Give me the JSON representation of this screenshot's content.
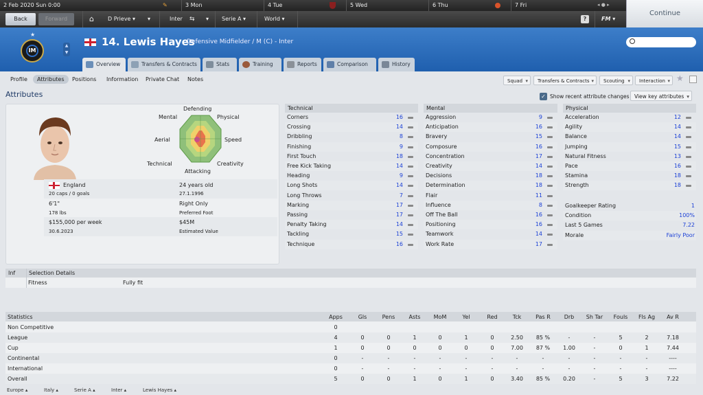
{
  "calendar": {
    "date": "2 Feb 2020",
    "day": "Sun",
    "time": "0:00",
    "days": [
      {
        "n": "3",
        "d": "Mon"
      },
      {
        "n": "4",
        "d": "Tue"
      },
      {
        "n": "5",
        "d": "Wed"
      },
      {
        "n": "6",
        "d": "Thu"
      },
      {
        "n": "7",
        "d": "Fri"
      }
    ]
  },
  "nav": {
    "back": "Back",
    "forward": "Forward",
    "manager": "D Prieve",
    "club": "Inter",
    "league": "Serie A",
    "world": "World",
    "help": "?",
    "fm": "FM",
    "continue": "Continue"
  },
  "player": {
    "title": "14. Lewis Hayes",
    "role": "Defensive Midfielder / M (C) - Inter"
  },
  "tabs": [
    "Overview",
    "Transfers & Contracts",
    "Stats",
    "Training",
    "Reports",
    "Comparison",
    "History"
  ],
  "subnav": [
    "Profile",
    "Attributes",
    "Positions",
    "Information",
    "Private Chat",
    "Notes"
  ],
  "actions": [
    "Squad",
    "Transfers & Contracts",
    "Scouting",
    "Interaction"
  ],
  "section_title": "Attributes",
  "show_recent": "Show recent attribute changes",
  "view_key": "View key attributes",
  "radar": {
    "labels": [
      "Defending",
      "Physical",
      "Speed",
      "Creativity",
      "Attacking",
      "Technical",
      "Aerial",
      "Mental"
    ]
  },
  "info": [
    {
      "main": "England",
      "sub": "20 caps / 0 goals",
      "rmain": "24 years old",
      "rsub": "27.1.1996"
    },
    {
      "main": "6'1\"",
      "sub": "178 lbs",
      "rmain": "Right Only",
      "rsub": "Preferred Foot"
    },
    {
      "main": "$155,000 per week",
      "sub": "30.6.2023",
      "rmain": "$45M",
      "rsub": "Estimated Value"
    }
  ],
  "technical": {
    "title": "Technical",
    "rows": [
      [
        "Corners",
        "16"
      ],
      [
        "Crossing",
        "14"
      ],
      [
        "Dribbling",
        "8"
      ],
      [
        "Finishing",
        "9"
      ],
      [
        "First Touch",
        "18"
      ],
      [
        "Free Kick Taking",
        "14"
      ],
      [
        "Heading",
        "9"
      ],
      [
        "Long Shots",
        "14"
      ],
      [
        "Long Throws",
        "7"
      ],
      [
        "Marking",
        "17"
      ],
      [
        "Passing",
        "17"
      ],
      [
        "Penalty Taking",
        "14"
      ],
      [
        "Tackling",
        "15"
      ],
      [
        "Technique",
        "16"
      ]
    ]
  },
  "mental": {
    "title": "Mental",
    "rows": [
      [
        "Aggression",
        "9"
      ],
      [
        "Anticipation",
        "16"
      ],
      [
        "Bravery",
        "15"
      ],
      [
        "Composure",
        "16"
      ],
      [
        "Concentration",
        "17"
      ],
      [
        "Creativity",
        "14"
      ],
      [
        "Decisions",
        "18"
      ],
      [
        "Determination",
        "18"
      ],
      [
        "Flair",
        "11"
      ],
      [
        "Influence",
        "8"
      ],
      [
        "Off The Ball",
        "16"
      ],
      [
        "Positioning",
        "16"
      ],
      [
        "Teamwork",
        "14"
      ],
      [
        "Work Rate",
        "17"
      ]
    ]
  },
  "physical": {
    "title": "Physical",
    "rows": [
      [
        "Acceleration",
        "12"
      ],
      [
        "Agility",
        "14"
      ],
      [
        "Balance",
        "14"
      ],
      [
        "Jumping",
        "15"
      ],
      [
        "Natural Fitness",
        "13"
      ],
      [
        "Pace",
        "16"
      ],
      [
        "Stamina",
        "18"
      ],
      [
        "Strength",
        "18"
      ]
    ]
  },
  "misc": [
    [
      "Goalkeeper Rating",
      "1"
    ],
    [
      "Condition",
      "100%"
    ],
    [
      "Last 5 Games",
      "7.22"
    ],
    [
      "Morale",
      "Fairly Poor"
    ]
  ],
  "selection": {
    "inf": "Inf",
    "header": "Selection Details",
    "label": "Fitness",
    "value": "Fully fit"
  },
  "stats": {
    "headers": [
      "Statistics",
      "Apps",
      "Gls",
      "Pens",
      "Asts",
      "MoM",
      "Yel",
      "Red",
      "Tck",
      "Pas R",
      "Drb",
      "Sh Tar",
      "Fouls",
      "Fls Ag",
      "Av R"
    ],
    "rows": [
      [
        "Non Competitive",
        "0",
        "",
        "",
        "",
        "",
        "",
        "",
        "",
        "",
        "",
        "",
        "",
        "",
        ""
      ],
      [
        "League",
        "4",
        "0",
        "0",
        "1",
        "0",
        "1",
        "0",
        "2.50",
        "85 %",
        "-",
        "-",
        "5",
        "2",
        "7.18"
      ],
      [
        "Cup",
        "1",
        "0",
        "0",
        "0",
        "0",
        "0",
        "0",
        "7.00",
        "87 %",
        "1.00",
        "-",
        "0",
        "1",
        "7.44"
      ],
      [
        "Continental",
        "0",
        "-",
        "-",
        "-",
        "-",
        "-",
        "-",
        "-",
        "-",
        "-",
        "-",
        "-",
        "-",
        "----"
      ],
      [
        "International",
        "0",
        "-",
        "-",
        "-",
        "-",
        "-",
        "-",
        "-",
        "-",
        "-",
        "-",
        "-",
        "-",
        "----"
      ],
      [
        "Overall",
        "5",
        "0",
        "0",
        "1",
        "0",
        "1",
        "0",
        "3.40",
        "85 %",
        "0.20",
        "-",
        "5",
        "3",
        "7.22"
      ]
    ]
  },
  "breadcrumb": [
    "Europe",
    "Italy",
    "Serie A",
    "Inter",
    "Lewis Hayes"
  ],
  "colors": {
    "accent": "#1f5fae",
    "value": "#1a3fd6"
  }
}
